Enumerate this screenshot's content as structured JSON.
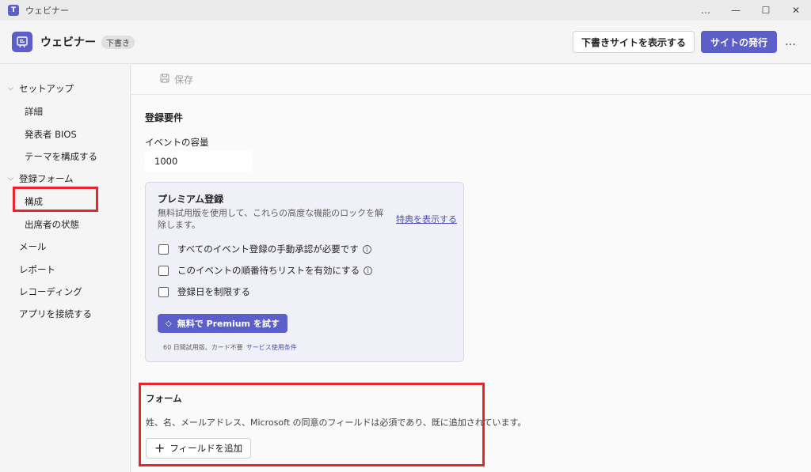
{
  "window": {
    "title": "ウェビナー",
    "controls": [
      "…",
      "—",
      "☐",
      "✕"
    ]
  },
  "header": {
    "title": "ウェビナー",
    "badge": "下書き",
    "preview_button": "下書きサイトを表示する",
    "publish_button": "サイトの発行",
    "more": "…"
  },
  "sidebar": {
    "setup_group": "セットアップ",
    "setup_items": [
      "詳細",
      "発表者 BIOS",
      "テーマを構成する"
    ],
    "registration_group": "登録フォーム",
    "registration_items": [
      "構成",
      "出席者の状態"
    ],
    "top_items": [
      "メール",
      "レポート",
      "レコーディング",
      "アプリを接続する"
    ]
  },
  "toolbar": {
    "save": "保存"
  },
  "main": {
    "section_title": "登録要件",
    "capacity_label": "イベントの容量",
    "capacity_value": "1000",
    "premium": {
      "title": "プレミアム登録",
      "description": "無料試用版を使用して、これらの高度な機能のロックを解除します。",
      "link": "特典を表示する",
      "options": [
        "すべてのイベント登録の手動承認が必要です",
        "このイベントの順番待ちリストを有効にする",
        "登録日を制限する"
      ],
      "try_button": "無料で Premium を試す",
      "footnote": "60 日間試用版、カード不要",
      "terms": "サービス使用条件"
    },
    "form": {
      "title": "フォーム",
      "description": "姓、名、メールアドレス、Microsoft の同意のフィールドは必須であり、既に追加されています。",
      "add_button": "フィールドを追加"
    }
  },
  "colors": {
    "accent": "#5b5fc7",
    "highlight": "#e8252a"
  }
}
